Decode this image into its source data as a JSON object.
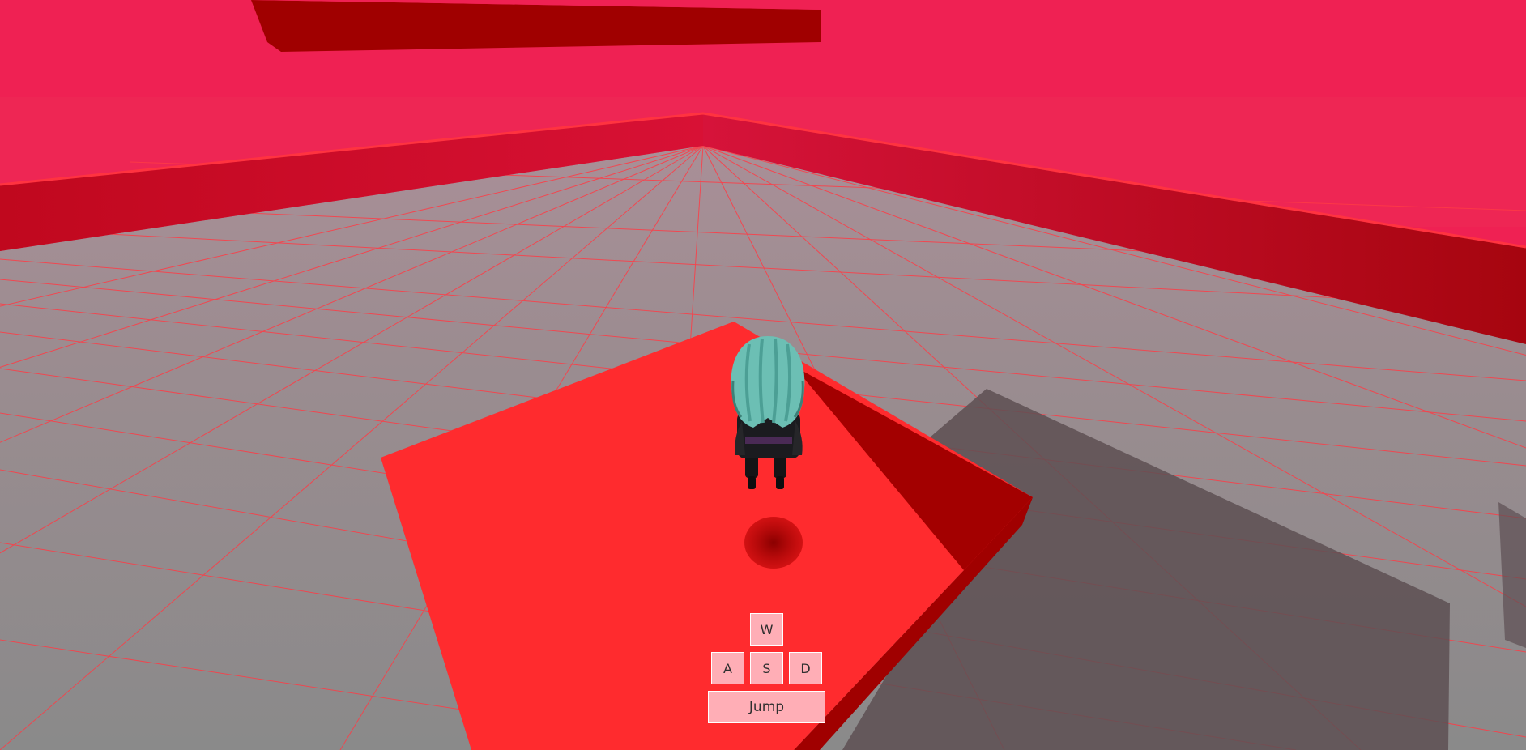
{
  "controls": {
    "up_label": "W",
    "left_label": "A",
    "down_label": "S",
    "right_label": "D",
    "jump_label": "Jump"
  },
  "colors": {
    "sky": "#ef2153",
    "floor": "#949494",
    "grid_line": "#ff3b45",
    "platform": "#ff2b2e",
    "platform_side": "#a30000",
    "wall": "#b5081f",
    "key_background": "#ffaeb6",
    "character_hair": "#6cbfb4",
    "character_body": "#1b1b1f"
  }
}
